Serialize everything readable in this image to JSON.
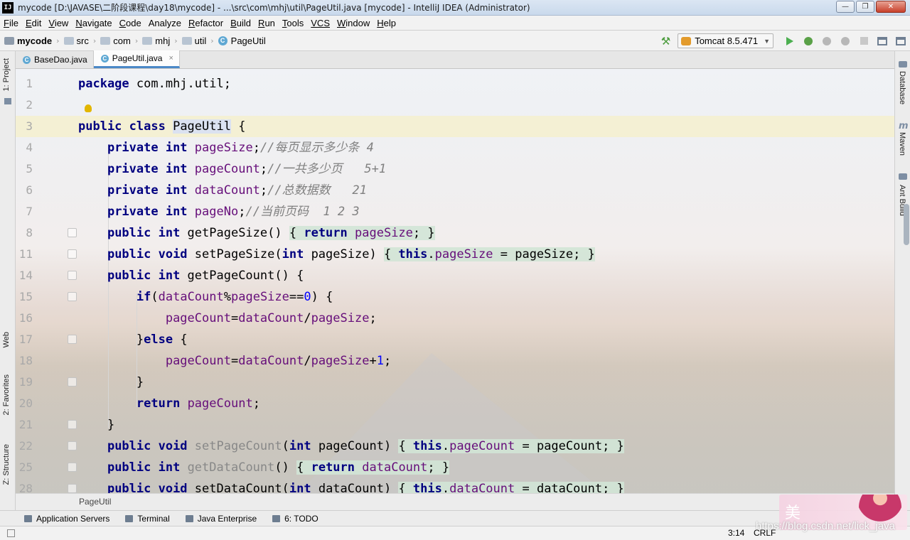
{
  "window": {
    "logo": "IJ",
    "title": "mycode [D:\\JAVASE\\二阶段课程\\day18\\mycode] - ...\\src\\com\\mhj\\util\\PageUtil.java [mycode] - IntelliJ IDEA (Administrator)",
    "min": "—",
    "max": "❐",
    "close": "✕"
  },
  "menu": [
    {
      "u": "F",
      "rest": "ile"
    },
    {
      "u": "E",
      "rest": "dit"
    },
    {
      "u": "V",
      "rest": "iew"
    },
    {
      "u": "N",
      "rest": "avigate"
    },
    {
      "u": "C",
      "rest": "ode"
    },
    {
      "u": "",
      "rest": "Analyze"
    },
    {
      "u": "R",
      "rest": "efactor"
    },
    {
      "u": "B",
      "rest": "uild"
    },
    {
      "u": "R",
      "rest": "un"
    },
    {
      "u": "T",
      "rest": "ools"
    },
    {
      "u": "VCS",
      "rest": ""
    },
    {
      "u": "W",
      "rest": "indow"
    },
    {
      "u": "H",
      "rest": "elp"
    }
  ],
  "nav": {
    "project": "mycode",
    "src": "src",
    "com": "com",
    "mhj": "mhj",
    "util": "util",
    "cls": "PageUtil",
    "run_config": "Tomcat 8.5.471"
  },
  "left_tabs": {
    "project": "1: Project",
    "web": "Web",
    "favorites": "2: Favorites",
    "structure": "Z: Structure"
  },
  "right_tabs": {
    "database": "Database",
    "maven": "Maven",
    "ant": "Ant Build"
  },
  "tabs": [
    {
      "label": "BaseDao.java"
    },
    {
      "label": "PageUtil.java"
    }
  ],
  "gutter": [
    "1",
    "2",
    "3",
    "4",
    "5",
    "6",
    "7",
    "8",
    "11",
    "14",
    "15",
    "16",
    "17",
    "18",
    "19",
    "20",
    "21",
    "22",
    "25",
    "28"
  ],
  "code": {
    "l1_kw": "package",
    "l1_rest": " com.mhj.util;",
    "l3_kw": "public class",
    "l3_name": "PageUtil",
    "l3_brace": " {",
    "l4_kw": "private int",
    "l4_fld": "pageSize",
    "l4_cmt": "//每页显示多少条 4",
    "l5_kw": "private int",
    "l5_fld": "pageCount",
    "l5_cmt": "//一共多少页   5+1",
    "l6_kw": "private int",
    "l6_fld": "dataCount",
    "l6_cmt": "//总数据数   21",
    "l7_kw": "private int",
    "l7_fld": "pageNo",
    "l7_cmt": "//当前页码  1 2 3",
    "l8_kw": "public int",
    "l8_name": " getPageSize()",
    "l8_ret": "return",
    "l8_fld": "pageSize",
    "l11_kw": "public void",
    "l11_name": " setPageSize(",
    "l11_int": "int",
    "l11_param": " pageSize)",
    "l11_this": "this",
    "l11_fld": "pageSize",
    "l11_rest": " = pageSize;",
    "l14_kw": "public int",
    "l14_name": " getPageCount() {",
    "l15_if": "if",
    "l15_a": "dataCount",
    "l15_pct": "%",
    "l15_b": "pageSize",
    "l15_eq": "==",
    "l15_zero": "0",
    "l15_end": ") {",
    "l16_a": "pageCount",
    "l16_b": "dataCount",
    "l16_c": "pageSize",
    "l17_else": "else",
    "l18_a": "pageCount",
    "l18_b": "dataCount",
    "l18_c": "pageSize",
    "l18_plus": "+",
    "l18_one": "1",
    "l20_ret": "return",
    "l20_fld": "pageCount",
    "l22_kw": "public void",
    "l22_name": "setPageCount",
    "l22_int": "int",
    "l22_param": " pageCount)",
    "l22_this": "this",
    "l22_fld": "pageCount",
    "l22_rest": " = pageCount;",
    "l25_kw": "public int",
    "l25_name": "getDataCount",
    "l25_ret": "return",
    "l25_fld": "dataCount",
    "l28_kw": "public void",
    "l28_name": "setDataCount",
    "l28_int": "int",
    "l28_param": " dataCount)",
    "l28_this": "this",
    "l28_fld": "dataCount",
    "l28_rest": " = dataCount;"
  },
  "editor_breadcrumb": "PageUtil",
  "bottom_tools": [
    {
      "label": "Application Servers"
    },
    {
      "label": "Terminal"
    },
    {
      "label": "Java Enterprise"
    },
    {
      "label": "6: TODO"
    }
  ],
  "status": {
    "caret": "3:14",
    "line_sep": "CRLF"
  },
  "watermark": {
    "glyph": "美",
    "url": "https://blog.csdn.net/lick_java"
  }
}
